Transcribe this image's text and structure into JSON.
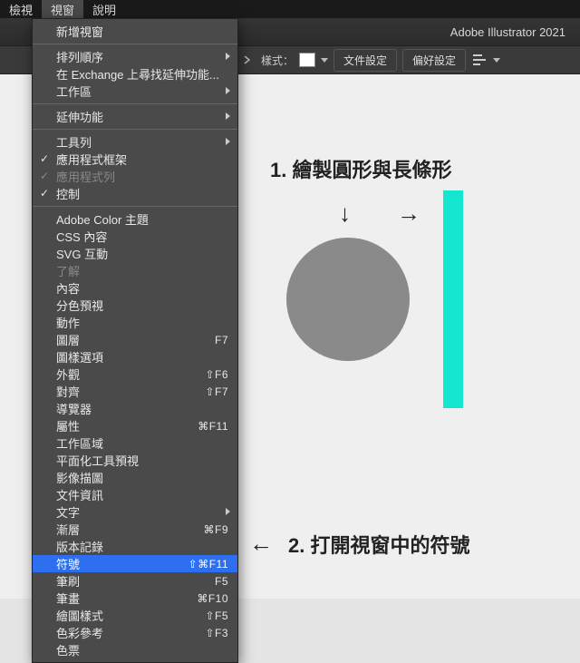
{
  "menubar": {
    "items": [
      "檢視",
      "視窗",
      "說明"
    ],
    "active_index": 1
  },
  "app_title": "Adobe Illustrator 2021",
  "toolbar": {
    "style_label": "樣式：",
    "doc_settings": "文件設定",
    "pref_settings": "偏好設定"
  },
  "menu": {
    "items": [
      {
        "label": "新增視窗"
      },
      {
        "sep": true
      },
      {
        "label": "排列順序",
        "submenu": true
      },
      {
        "label": "在 Exchange 上尋找延伸功能..."
      },
      {
        "label": "工作區",
        "submenu": true
      },
      {
        "sep": true
      },
      {
        "label": "延伸功能",
        "submenu": true
      },
      {
        "sep": true
      },
      {
        "label": "工具列",
        "submenu": true
      },
      {
        "label": "應用程式框架",
        "checked": true
      },
      {
        "label": "應用程式列",
        "checked": true,
        "disabled": true
      },
      {
        "label": "控制",
        "checked": true
      },
      {
        "sep": true
      },
      {
        "label": "Adobe Color 主題"
      },
      {
        "label": "CSS 內容"
      },
      {
        "label": "SVG 互動"
      },
      {
        "label": "了解",
        "disabled": true
      },
      {
        "label": "內容"
      },
      {
        "label": "分色預視"
      },
      {
        "label": "動作"
      },
      {
        "label": "圖層",
        "shortcut": "F7"
      },
      {
        "label": "圖樣選項"
      },
      {
        "label": "外觀",
        "shortcut": "⇧F6"
      },
      {
        "label": "對齊",
        "shortcut": "⇧F7"
      },
      {
        "label": "導覽器"
      },
      {
        "label": "屬性",
        "shortcut": "⌘F11"
      },
      {
        "label": "工作區域"
      },
      {
        "label": "平面化工具預視"
      },
      {
        "label": "影像描圖"
      },
      {
        "label": "文件資訊"
      },
      {
        "label": "文字",
        "submenu": true
      },
      {
        "label": "漸層",
        "shortcut": "⌘F9"
      },
      {
        "label": "版本記錄"
      },
      {
        "label": "符號",
        "shortcut": "⇧⌘F11",
        "highlight": true
      },
      {
        "label": "筆刷",
        "shortcut": "F5"
      },
      {
        "label": "筆畫",
        "shortcut": "⌘F10"
      },
      {
        "label": "繪圖樣式",
        "shortcut": "⇧F5"
      },
      {
        "label": "色彩參考",
        "shortcut": "⇧F3"
      },
      {
        "label": "色票"
      }
    ]
  },
  "annotations": {
    "step1": "1. 繪製圓形與長條形",
    "step2": "2. 打開視窗中的符號",
    "arrow_down": "↓",
    "arrow_right": "→",
    "arrow_left": "←"
  }
}
